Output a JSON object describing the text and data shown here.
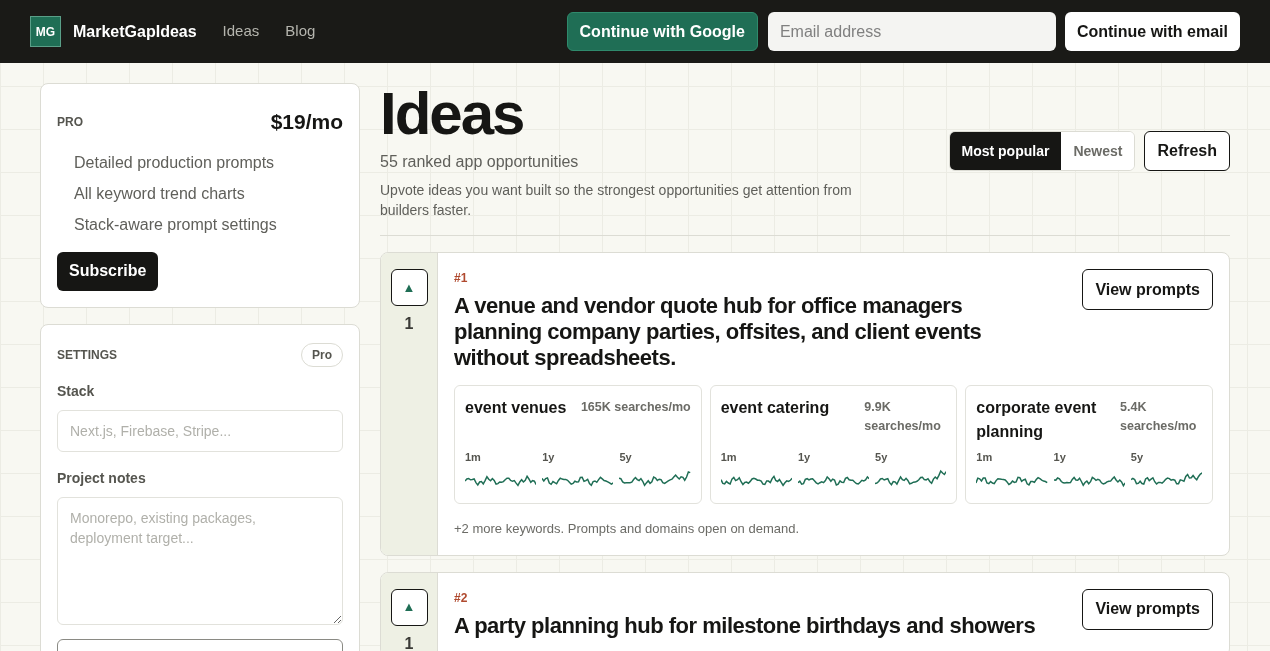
{
  "header": {
    "logo": "MG",
    "brand": "MarketGapIdeas",
    "nav": [
      {
        "label": "Ideas"
      },
      {
        "label": "Blog"
      }
    ],
    "google_button": "Continue with Google",
    "email": {
      "placeholder": "Email address"
    },
    "email_button": "Continue with email"
  },
  "pro_card": {
    "label": "PRO",
    "price": "$19/mo",
    "features": [
      "Detailed production prompts",
      "All keyword trend charts",
      "Stack-aware prompt settings"
    ],
    "button": "Subscribe"
  },
  "settings": {
    "title": "SETTINGS",
    "badge": "Pro",
    "stack_label": "Stack",
    "stack": {
      "placeholder": "Next.js, Firebase, Stripe..."
    },
    "notes_label": "Project notes",
    "notes": {
      "placeholder": "Monorepo, existing packages, deployment target..."
    }
  },
  "page": {
    "title": "Ideas",
    "subtitle": "55 ranked app opportunities",
    "description": "Upvote ideas you want built so the strongest opportunities get attention from builders faster.",
    "sort_tabs": [
      {
        "label": "Most popular",
        "selected": true
      },
      {
        "label": "Newest",
        "selected": false
      }
    ],
    "refresh": "Refresh"
  },
  "ideas": [
    {
      "upvote": "▲",
      "votes": "1",
      "rank": "#1",
      "title": "A venue and vendor quote hub for office managers planning company parties, offsites, and client events without spreadsheets.",
      "button": "View prompts",
      "keywords": [
        {
          "name": "event venues",
          "volume": "165K searches/mo",
          "periods": [
            "1m",
            "1y",
            "5y"
          ]
        },
        {
          "name": "event catering",
          "volume": "9.9K searches/mo",
          "periods": [
            "1m",
            "1y",
            "5y"
          ]
        },
        {
          "name": "corporate event planning",
          "volume": "5.4K searches/mo",
          "periods": [
            "1m",
            "1y",
            "5y"
          ]
        }
      ],
      "more": "+2 more keywords. Prompts and domains open on demand."
    },
    {
      "upvote": "▲",
      "votes": "1",
      "rank": "#2",
      "title": "A party planning hub for milestone birthdays and showers",
      "button": "View prompts"
    }
  ]
}
